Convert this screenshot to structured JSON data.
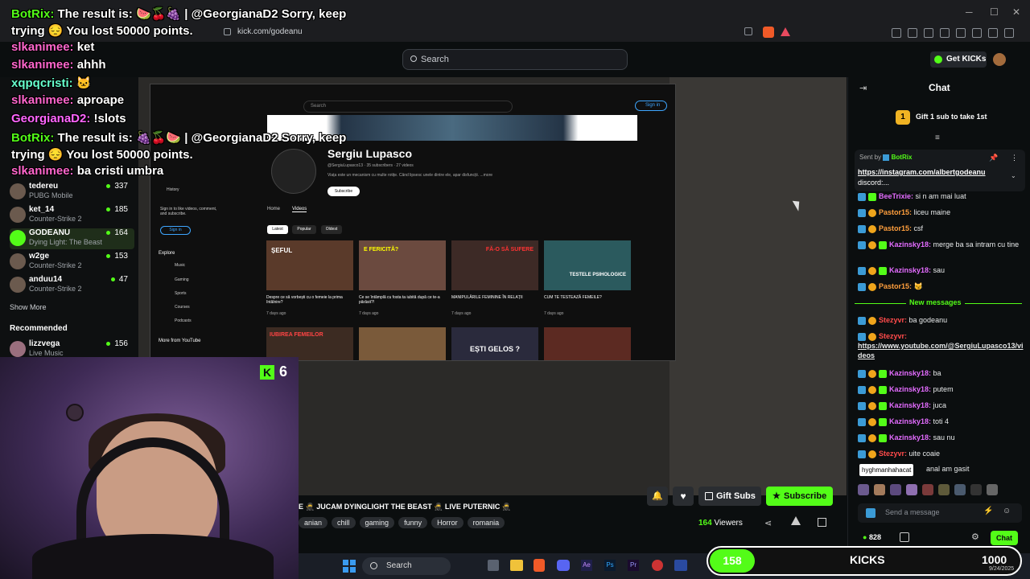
{
  "browser": {
    "url": "kick.com/godeanu"
  },
  "header": {
    "search_placeholder": "Search",
    "get_kicks": "Get KICKs"
  },
  "overlay_chat": [
    {
      "user": "BotRix:",
      "text": "The result is: 🍉🍒🍇 | @GeorgianaD2 Sorry, keep",
      "color": "#53fc18"
    },
    {
      "user": "",
      "text": "trying 😔 You lost 50000 points.",
      "color": "#ffffff"
    },
    {
      "user": "slkanimee:",
      "text": "ket",
      "color": "#ff66cc"
    },
    {
      "user": "slkanimee:",
      "text": "ahhh",
      "color": "#ff66cc"
    },
    {
      "user": "xqpqcristi:",
      "text": "🐱",
      "color": "#66ffcc"
    },
    {
      "user": "slkanimee:",
      "text": "aproape",
      "color": "#ff66cc"
    },
    {
      "user": "GeorgianaD2:",
      "text": "!slots",
      "color": "#ff66ff"
    },
    {
      "user": "BotRix:",
      "text": "The result is: 🍇🍒🍉 | @GeorgianaD2 Sorry, keep",
      "color": "#53fc18"
    },
    {
      "user": "",
      "text": "trying 😔 You lost 50000 points.",
      "color": "#ffffff"
    },
    {
      "user": "slkanimee:",
      "text": "ba cristi umbra",
      "color": "#ff66cc"
    }
  ],
  "sidebar": {
    "following": [
      {
        "name": "tedereu",
        "game": "PUBG Mobile",
        "viewers": "337"
      },
      {
        "name": "ket_14",
        "game": "Counter-Strike 2",
        "viewers": "185"
      },
      {
        "name": "GODEANU",
        "game": "Dying Light: The Beast",
        "viewers": "164"
      },
      {
        "name": "w2ge",
        "game": "Counter-Strike 2",
        "viewers": "153"
      },
      {
        "name": "anduu14",
        "game": "Counter-Strike 2",
        "viewers": "47"
      }
    ],
    "show_more": "Show More",
    "recommended_title": "Recommended",
    "recommended": [
      {
        "name": "lizzvega",
        "game": "Live Music",
        "viewers": "156"
      }
    ]
  },
  "youtube": {
    "search": "Search",
    "sign_in": "Sign in",
    "channel_name": "Sergiu Lupasco",
    "handle": "@SergiuLupasco13 · 35 subscribers · 27 videos",
    "desc": "Viața este un mecanism cu multe rotițe. Când lipsesc unele dintre ele, apar disfuncții. ...more",
    "subscribe": "Subscribe",
    "tabs": [
      "Home",
      "Videos"
    ],
    "filters": [
      "Latest",
      "Popular",
      "Oldest"
    ],
    "side": [
      "History",
      "Sign in to like videos, comment, and subscribe.",
      "Sign in",
      "Explore",
      "Music",
      "Gaming",
      "Sports",
      "Courses",
      "Podcasts",
      "More from YouTube"
    ],
    "videos": [
      {
        "title": "Despre ce să vorbești cu o femeie la prima întâlnire?",
        "meta": "7 days ago",
        "thumb": "ȘEFUL",
        "color": "#5a3a2a"
      },
      {
        "title": "Ce se întâmplă cu fosta ta iubită după ce te-a părăsit?!",
        "meta": "7 days ago",
        "thumb": "E FERICITĂ?",
        "color": "#6b4a3f"
      },
      {
        "title": "MANIPULĂRILE FEMININE ÎN RELAȚII",
        "meta": "7 days ago",
        "thumb": "FĂ-O SĂ SUFERE",
        "color": "#3d2a26"
      },
      {
        "title": "CUM TE TESTEAZĂ FEMEILE?",
        "meta": "7 days ago",
        "thumb": "TESTELE PSIHOLOGICE",
        "color": "#2b5a5e"
      }
    ],
    "row2": [
      "IUBIREA FEMEILOR",
      "",
      "EȘTI GELOS ?",
      ""
    ]
  },
  "webcam": {
    "badge_count": "6"
  },
  "stream": {
    "title": "E 🥷 JUCAM DYINGLIGHT THE BEAST 🥷 LIVE PUTERNIC 🥷",
    "tags": [
      "anian",
      "chill",
      "gaming",
      "funny",
      "Horror",
      "romania"
    ],
    "gift_subs": "Gift Subs",
    "subscribe": "Subscribe",
    "viewers": "164",
    "viewers_label": "Viewers"
  },
  "chat": {
    "title": "Chat",
    "gift_banner": "Gift 1 sub to take 1st",
    "gift_count": "1",
    "pinned_by": "Sent by",
    "pinned_user": "BotRix",
    "pinned_link": "https://instagram.com/albertgodeanu",
    "pinned_text": "discord:...",
    "new_messages": "New messages",
    "messages_top": [
      {
        "user": "BeeTrixie:",
        "text": "si n am mai luat",
        "cls": "pink"
      },
      {
        "user": "Pastor15:",
        "text": "liceu maine",
        "cls": "orange"
      },
      {
        "user": "Pastor15:",
        "text": "csf",
        "cls": "orange"
      },
      {
        "user": "Kazinsky18:",
        "text": "merge ba sa intram cu tine",
        "cls": "pink"
      },
      {
        "user": "Kazinsky18:",
        "text": "sau",
        "cls": "pink"
      },
      {
        "user": "Pastor15:",
        "text": "😼",
        "cls": "orange"
      }
    ],
    "messages_bottom": [
      {
        "user": "Stezyvr:",
        "text": "ba godeanu",
        "cls": "red"
      },
      {
        "user": "Stezyvr:",
        "text": "",
        "cls": "red"
      },
      {
        "user": "Kazinsky18:",
        "text": "ba",
        "cls": "pink"
      },
      {
        "user": "Kazinsky18:",
        "text": "putem",
        "cls": "pink"
      },
      {
        "user": "Kazinsky18:",
        "text": "juca",
        "cls": "pink"
      },
      {
        "user": "Kazinsky18:",
        "text": "toti 4",
        "cls": "pink"
      },
      {
        "user": "Kazinsky18:",
        "text": "sau nu",
        "cls": "pink"
      },
      {
        "user": "Stezyvr:",
        "text": "uite coaie",
        "cls": "red"
      }
    ],
    "link_msg": "https://www.youtube.com/@SergiuLupasco13/videos",
    "tooltip": "hyghmanhahacat",
    "tooltip_tail": "anal am gasit",
    "input_placeholder": "Send a message",
    "points": "828",
    "chat_button": "Chat"
  },
  "taskbar": {
    "search": "Search",
    "kicks_value": "158",
    "kicks_label": "KICKS",
    "kicks_goal": "1000",
    "date": "9/24/2025"
  },
  "colors": {
    "kick_green": "#53fc18",
    "bg": "#0b0e0f"
  }
}
